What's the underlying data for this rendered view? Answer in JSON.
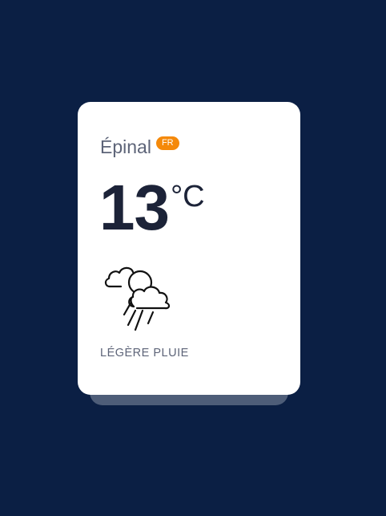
{
  "weather": {
    "city": "Épinal",
    "country_code": "FR",
    "temperature": "13",
    "unit": "°C",
    "condition": "LÉGÈRE PLUIE",
    "icon": "cloud-sun-rain-icon"
  },
  "colors": {
    "background": "#0b1f44",
    "card": "#ffffff",
    "badge": "#f5890a",
    "text_primary": "#1c2338",
    "text_secondary": "#5d6478"
  }
}
